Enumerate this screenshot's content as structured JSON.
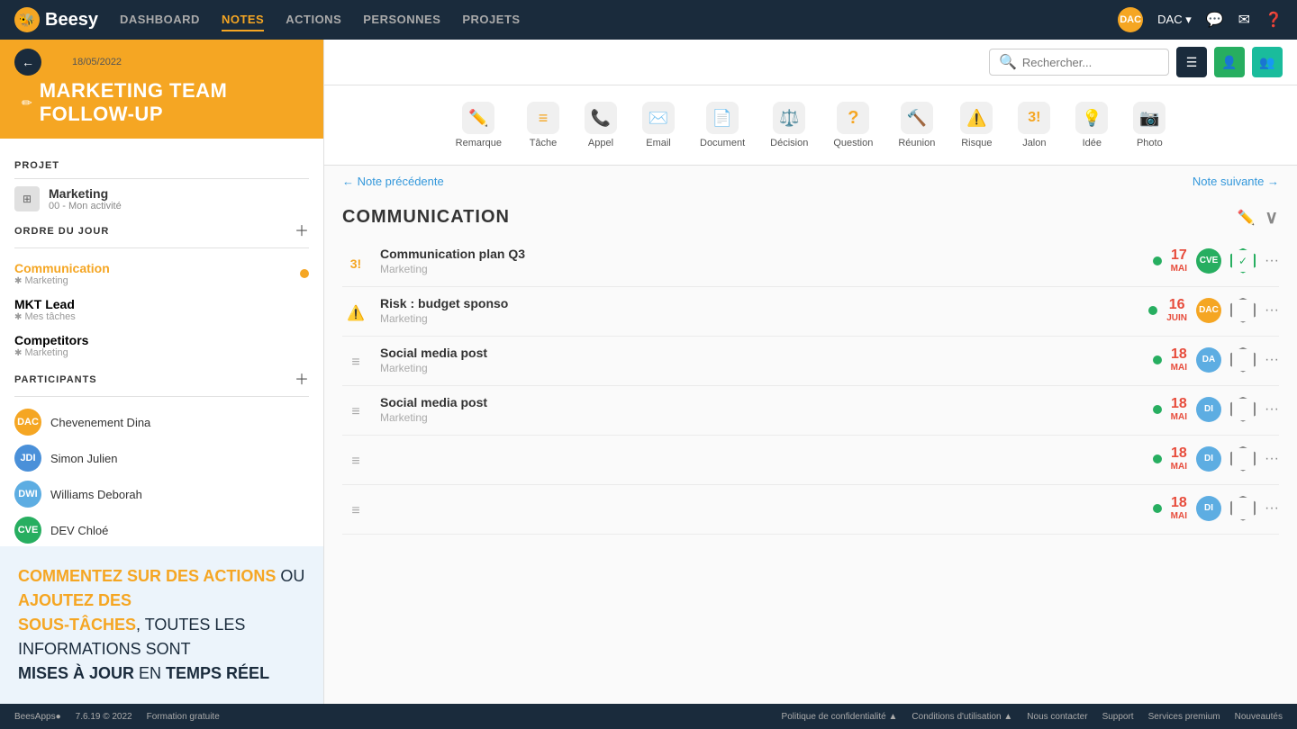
{
  "app": {
    "name": "Beesy",
    "version": "7.6.19 © 2022"
  },
  "nav": {
    "items": [
      {
        "id": "dashboard",
        "label": "DASHBOARD",
        "active": false
      },
      {
        "id": "notes",
        "label": "NOTES",
        "active": true
      },
      {
        "id": "actions",
        "label": "ACTIONS",
        "active": false
      },
      {
        "id": "personnes",
        "label": "PERSONNES",
        "active": false
      },
      {
        "id": "projets",
        "label": "PROJETS",
        "active": false
      }
    ],
    "user": "DAC",
    "search_placeholder": "Rechercher..."
  },
  "note": {
    "date": "18/05/2022",
    "title": "MARKETING TEAM FOLLOW-UP"
  },
  "project": {
    "section_label": "PROJET",
    "name": "Marketing",
    "sub": "00 - Mon activité"
  },
  "agenda": {
    "section_label": "ORDRE DU JOUR",
    "items": [
      {
        "name": "Communication",
        "sub": "Marketing",
        "active": true,
        "dot": true
      },
      {
        "name": "MKT Lead",
        "sub": "Mes tâches",
        "active": false,
        "dot": false
      },
      {
        "name": "Competitors",
        "sub": "Marketing",
        "active": false,
        "dot": false
      }
    ]
  },
  "participants": {
    "section_label": "PARTICIPANTS",
    "items": [
      {
        "id": "DAC",
        "name": "Chevenement Dina",
        "color": "dac"
      },
      {
        "id": "JDI",
        "name": "Simon Julien",
        "color": "jdi"
      },
      {
        "id": "DWI",
        "name": "Williams Deborah",
        "color": "dwi"
      },
      {
        "id": "CVE",
        "name": "DEV Chloé",
        "color": "cve"
      }
    ]
  },
  "toolbar": {
    "items": [
      {
        "id": "remarque",
        "label": "Remarque",
        "icon": "✏️"
      },
      {
        "id": "tache",
        "label": "Tâche",
        "icon": "☰"
      },
      {
        "id": "appel",
        "label": "Appel",
        "icon": "📞"
      },
      {
        "id": "email",
        "label": "Email",
        "icon": "✉️"
      },
      {
        "id": "document",
        "label": "Document",
        "icon": "📄"
      },
      {
        "id": "decision",
        "label": "Décision",
        "icon": "⚖️"
      },
      {
        "id": "question",
        "label": "Question",
        "icon": "?"
      },
      {
        "id": "reunion",
        "label": "Réunion",
        "icon": "🔨"
      },
      {
        "id": "risque",
        "label": "Risque",
        "icon": "⚠️"
      },
      {
        "id": "jalon",
        "label": "Jalon",
        "icon": "3!"
      },
      {
        "id": "idee",
        "label": "Idée",
        "icon": "💡"
      },
      {
        "id": "photo",
        "label": "Photo",
        "icon": "📷"
      }
    ]
  },
  "navigation": {
    "prev": "← Note précédente",
    "next": "Note suivante →"
  },
  "section": {
    "title": "COMMUNICATION",
    "entries": [
      {
        "id": 1,
        "type": "jalon",
        "icon": "3!",
        "title": "Communication plan Q3",
        "sub": "Marketing",
        "date_day": "17",
        "date_month": "MAI",
        "avatar_id": "CVE",
        "avatar_color": "#27ae60",
        "status": "check"
      },
      {
        "id": 2,
        "type": "risque",
        "icon": "⚠️",
        "title": "Risk : budget sponso",
        "sub": "Marketing",
        "date_day": "16",
        "date_month": "JUIN",
        "avatar_id": "DAC",
        "avatar_color": "#f5a623",
        "status": "hex"
      },
      {
        "id": 3,
        "type": "tache",
        "icon": "☰",
        "title": "Social media post",
        "sub": "Marketing",
        "date_day": "18",
        "date_month": "MAI",
        "avatar_id": "DA",
        "avatar_color": "#5dade2",
        "status": "hex"
      },
      {
        "id": 4,
        "type": "tache",
        "icon": "☰",
        "title": "Social media post",
        "sub": "Marketing",
        "date_day": "18",
        "date_month": "MAI",
        "avatar_id": "DI",
        "avatar_color": "#5dade2",
        "status": "hex"
      },
      {
        "id": 5,
        "type": "unknown",
        "icon": "?",
        "title": "",
        "sub": "",
        "date_day": "18",
        "date_month": "MAI",
        "avatar_id": "DI",
        "avatar_color": "#5dade2",
        "status": "hex"
      },
      {
        "id": 6,
        "type": "unknown",
        "icon": "?",
        "title": "",
        "sub": "",
        "date_day": "18",
        "date_month": "MAI",
        "avatar_id": "DI",
        "avatar_color": "#5dade2",
        "status": "hex"
      }
    ]
  },
  "promo": {
    "line1_bold": "COMMENTEZ SUR DES ACTIONS",
    "line1_normal": " OU ",
    "line1_bold2": "AJOUTEZ DES",
    "line2_bold": "SOUS-TÂCHES",
    "line2_normal": ", TOUTES LES INFORMATIONS SONT",
    "line3_bold": "MISES À JOUR",
    "line3_normal": " EN ",
    "line3_bold2": "TEMPS RÉEL"
  },
  "footer": {
    "left": [
      {
        "label": "BeesApps●"
      },
      {
        "label": "7.6.19 © 2022"
      },
      {
        "label": "Formation gratuite"
      }
    ],
    "right": [
      {
        "label": "Politique de confidentialité ▲"
      },
      {
        "label": "Conditions d'utilisation ▲"
      },
      {
        "label": "Nous contacter"
      },
      {
        "label": "Support"
      },
      {
        "label": "Services premium"
      },
      {
        "label": "Nouveautés"
      }
    ]
  }
}
